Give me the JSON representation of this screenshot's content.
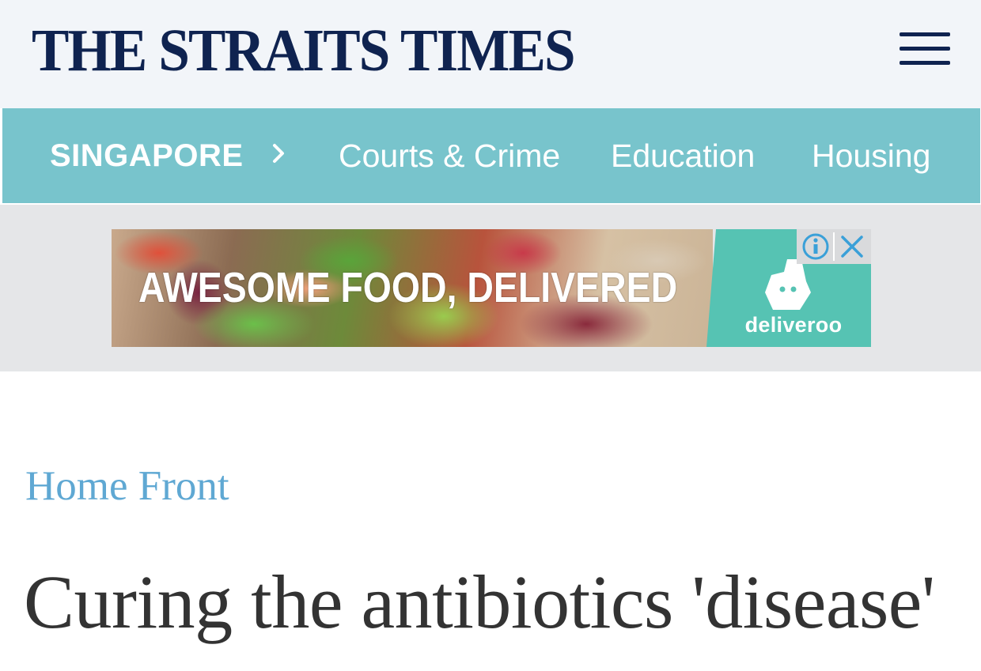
{
  "header": {
    "logo_text": "THE STRAITS TIMES",
    "menu_icon": "hamburger-menu-icon"
  },
  "nav": {
    "section": "SINGAPORE",
    "chevron_icon": "chevron-right-icon",
    "items": [
      {
        "label": "Courts & Crime"
      },
      {
        "label": "Education"
      },
      {
        "label": "Housing"
      }
    ]
  },
  "ad": {
    "headline": "AWESOME FOOD, DELIVERED",
    "brand": "deliveroo",
    "brand_icon": "deliveroo-kangaroo-icon",
    "info_icon": "info-icon",
    "close_icon": "close-icon"
  },
  "article": {
    "kicker": "Home Front",
    "title": "Curing the antibiotics 'disease'"
  },
  "colors": {
    "logo": "#0f2350",
    "nav_background": "#78c4cc",
    "kicker": "#5fa8d3",
    "headline": "#333333",
    "deliveroo_teal": "#56c3b3"
  }
}
